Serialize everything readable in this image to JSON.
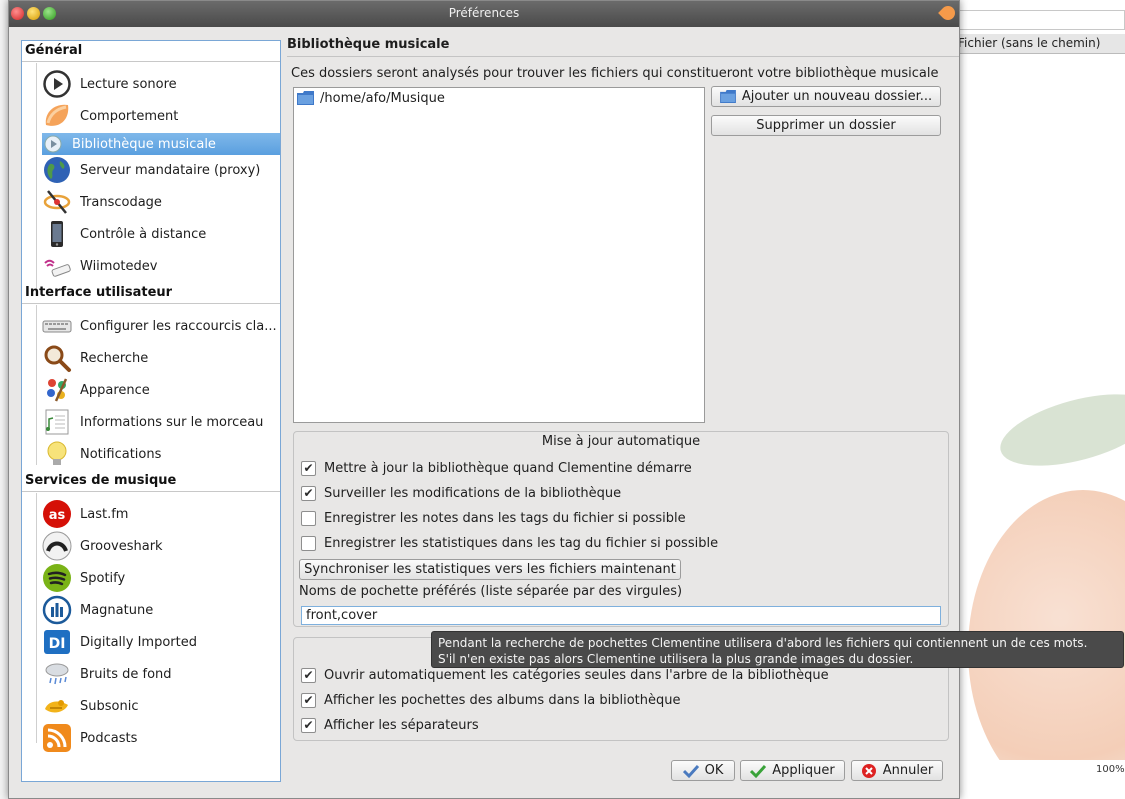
{
  "window": {
    "title": "Préférences"
  },
  "background": {
    "column_header": "Fichier (sans le chemin)",
    "zoom_text": "100%"
  },
  "sidebar": {
    "groups": [
      {
        "label": "Général"
      },
      {
        "label": "Interface utilisateur"
      },
      {
        "label": "Services de musique"
      }
    ],
    "items": [
      {
        "label": "Lecture sonore",
        "icon": "play-circle-icon"
      },
      {
        "label": "Comportement",
        "icon": "clementine-icon"
      },
      {
        "label": "Bibliothèque musicale",
        "icon": "library-icon",
        "selected": true
      },
      {
        "label": "Serveur mandataire (proxy)",
        "icon": "globe-icon"
      },
      {
        "label": "Transcodage",
        "icon": "transcode-icon"
      },
      {
        "label": "Contrôle à distance",
        "icon": "phone-icon"
      },
      {
        "label": "Wiimotedev",
        "icon": "wiimote-icon"
      },
      {
        "label": "Configurer les raccourcis cla...",
        "icon": "keyboard-icon"
      },
      {
        "label": "Recherche",
        "icon": "magnifier-icon"
      },
      {
        "label": "Apparence",
        "icon": "paint-icon"
      },
      {
        "label": "Informations sur le morceau",
        "icon": "song-info-icon"
      },
      {
        "label": "Notifications",
        "icon": "lightbulb-icon"
      },
      {
        "label": "Last.fm",
        "icon": "lastfm-icon"
      },
      {
        "label": "Grooveshark",
        "icon": "grooveshark-icon"
      },
      {
        "label": "Spotify",
        "icon": "spotify-icon"
      },
      {
        "label": "Magnatune",
        "icon": "magnatune-icon"
      },
      {
        "label": "Digitally Imported",
        "icon": "di-icon"
      },
      {
        "label": "Bruits de fond",
        "icon": "cloud-rain-icon"
      },
      {
        "label": "Subsonic",
        "icon": "subsonic-icon"
      },
      {
        "label": "Podcasts",
        "icon": "rss-icon"
      }
    ]
  },
  "main": {
    "title": "Bibliothèque musicale",
    "description": "Ces dossiers seront analysés pour trouver les fichiers qui constitueront votre bibliothèque musicale",
    "folders": [
      "/home/afo/Musique"
    ],
    "add_folder_label": "Ajouter un nouveau dossier...",
    "remove_folder_label": "Supprimer un dossier",
    "auto_update": {
      "title": "Mise à jour automatique",
      "options": [
        {
          "label": "Mettre à jour la bibliothèque quand Clementine démarre",
          "checked": true
        },
        {
          "label": "Surveiller les modifications de la bibliothèque",
          "checked": true
        },
        {
          "label": "Enregistrer les notes dans les tags du fichier si possible",
          "checked": false
        },
        {
          "label": "Enregistrer les statistiques dans les tag du fichier si possible",
          "checked": false
        }
      ],
      "sync_button": "Synchroniser les statistiques vers les fichiers maintenant",
      "cover_names_label": "Noms de pochette préférés (liste séparée par des virgules)",
      "cover_names_value": "front,cover"
    },
    "display": {
      "options": [
        {
          "label": "Ouvrir automatiquement les catégories seules dans l'arbre de la bibliothèque",
          "checked": true
        },
        {
          "label": "Afficher les pochettes des albums dans la bibliothèque",
          "checked": true
        },
        {
          "label": "Afficher les séparateurs",
          "checked": true
        }
      ]
    },
    "tooltip": {
      "line1": "Pendant la recherche de pochettes Clementine utilisera d'abord les fichiers qui contiennent un de ces mots.",
      "line2": "S'il n'en existe pas alors Clementine utilisera la plus grande images du dossier."
    }
  },
  "footer": {
    "ok_label": "OK",
    "apply_label": "Appliquer",
    "cancel_label": "Annuler"
  },
  "colors": {
    "selection": "#5a9fdf",
    "dialog_bg": "#e8e7e6",
    "tooltip_bg": "#4a4a4a"
  }
}
